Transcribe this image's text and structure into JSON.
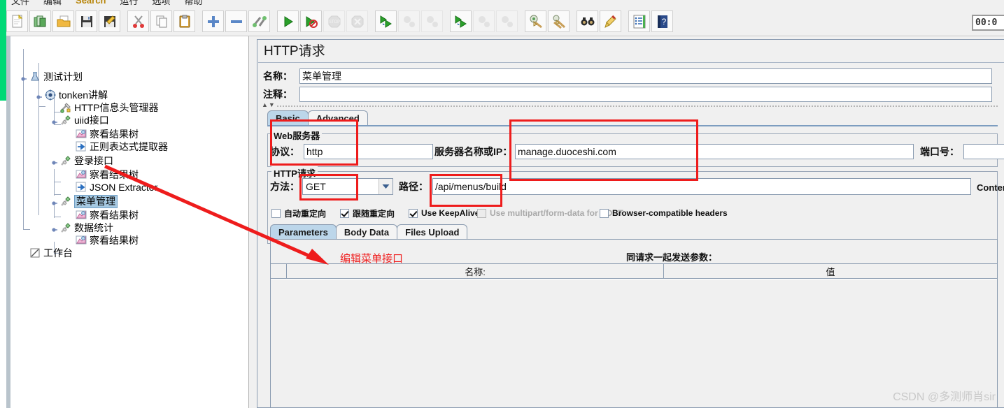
{
  "app": {
    "watermark": "CSDN @多测师肖sir",
    "timer": "00:0"
  },
  "menubar": {
    "items": [
      {
        "label": "文件",
        "accent": false
      },
      {
        "label": "编辑",
        "accent": false
      },
      {
        "label": "Search",
        "accent": true
      },
      {
        "label": "运行",
        "accent": false
      },
      {
        "label": "选项",
        "accent": false
      },
      {
        "label": "帮助",
        "accent": false
      }
    ]
  },
  "toolbar": {
    "groups": [
      {
        "buttons": [
          {
            "name": "new-test-plan-icon",
            "disabled": false
          },
          {
            "name": "templates-icon",
            "disabled": false
          },
          {
            "name": "open-icon",
            "disabled": false
          },
          {
            "name": "save-icon",
            "disabled": false
          },
          {
            "name": "save-as-icon",
            "disabled": false
          }
        ]
      },
      {
        "buttons": [
          {
            "name": "cut-icon",
            "disabled": false
          },
          {
            "name": "copy-icon",
            "disabled": false
          },
          {
            "name": "paste-icon",
            "disabled": false
          }
        ]
      },
      {
        "buttons": [
          {
            "name": "expand-all-icon",
            "disabled": false
          },
          {
            "name": "collapse-all-icon",
            "disabled": false
          },
          {
            "name": "toggle-icon",
            "disabled": false
          }
        ]
      },
      {
        "buttons": [
          {
            "name": "start-icon",
            "disabled": false
          },
          {
            "name": "start-no-pauses-icon",
            "disabled": false
          },
          {
            "name": "stop-icon",
            "disabled": true
          },
          {
            "name": "shutdown-icon",
            "disabled": true
          }
        ]
      },
      {
        "buttons": [
          {
            "name": "remote-start-icon",
            "disabled": false
          },
          {
            "name": "remote-stop-icon",
            "disabled": true
          },
          {
            "name": "remote-shutdown-icon",
            "disabled": true
          }
        ]
      },
      {
        "buttons": [
          {
            "name": "remote-start-all-icon",
            "disabled": false
          },
          {
            "name": "remote-stop-all-icon",
            "disabled": true
          },
          {
            "name": "remote-shutdown-all-icon",
            "disabled": true
          }
        ]
      },
      {
        "buttons": [
          {
            "name": "clear-icon",
            "disabled": false
          },
          {
            "name": "clear-all-icon",
            "disabled": false
          }
        ]
      },
      {
        "buttons": [
          {
            "name": "search-icon",
            "disabled": false
          },
          {
            "name": "clear-search-icon",
            "disabled": false
          }
        ]
      },
      {
        "buttons": [
          {
            "name": "function-helper-icon",
            "disabled": false
          },
          {
            "name": "help-icon",
            "disabled": false
          }
        ]
      }
    ]
  },
  "tree": {
    "nodes": [
      {
        "label": "测试计划",
        "depth": 0,
        "icon": "test-plan-icon",
        "selected": false,
        "expanded": true
      },
      {
        "label": "tonken讲解",
        "depth": 1,
        "icon": "thread-group-icon",
        "selected": false,
        "expanded": true
      },
      {
        "label": "HTTP信息头管理器",
        "depth": 2,
        "icon": "header-manager-icon",
        "selected": false,
        "expanded": null
      },
      {
        "label": "uiid接口",
        "depth": 2,
        "icon": "http-sampler-icon",
        "selected": false,
        "expanded": true
      },
      {
        "label": "察看结果树",
        "depth": 3,
        "icon": "view-results-icon",
        "selected": false,
        "expanded": null
      },
      {
        "label": "正则表达式提取器",
        "depth": 3,
        "icon": "extractor-icon",
        "selected": false,
        "expanded": null
      },
      {
        "label": "登录接口",
        "depth": 2,
        "icon": "http-sampler-icon",
        "selected": false,
        "expanded": true
      },
      {
        "label": "察看结果树",
        "depth": 3,
        "icon": "view-results-icon",
        "selected": false,
        "expanded": null
      },
      {
        "label": "JSON Extractor",
        "depth": 3,
        "icon": "extractor-icon",
        "selected": false,
        "expanded": null
      },
      {
        "label": "菜单管理",
        "depth": 2,
        "icon": "http-sampler-icon",
        "selected": true,
        "expanded": true
      },
      {
        "label": "察看结果树",
        "depth": 3,
        "icon": "view-results-icon",
        "selected": false,
        "expanded": null
      },
      {
        "label": "数据统计",
        "depth": 2,
        "icon": "http-sampler-icon",
        "selected": false,
        "expanded": true
      },
      {
        "label": "察看结果树",
        "depth": 3,
        "icon": "view-results-icon",
        "selected": false,
        "expanded": null
      },
      {
        "label": "工作台",
        "depth": 1,
        "icon": "workbench-icon",
        "selected": false,
        "expanded": null
      }
    ]
  },
  "panel": {
    "title": "HTTP请求",
    "name_label": "名称：",
    "name_value": "菜单管理",
    "comment_label": "注释：",
    "comment_value": "",
    "tabs": [
      {
        "label": "Basic",
        "active": true
      },
      {
        "label": "Advanced",
        "active": false
      }
    ],
    "webserver": {
      "group_title": "Web服务器",
      "protocol_label": "协议：",
      "protocol_value": "http",
      "servername_label": "服务器名称或IP：",
      "servername_value": "manage.duoceshi.com",
      "port_label": "端口号：",
      "port_value": ""
    },
    "httprequest": {
      "group_title": "HTTP请求",
      "method_label": "方法：",
      "method_value": "GET",
      "path_label": "路径：",
      "path_value": "/api/menus/build",
      "content_encoding_label": "Conten",
      "checkboxes": [
        {
          "label": "自动重定向",
          "checked": false,
          "disabled": false
        },
        {
          "label": "跟随重定向",
          "checked": true,
          "disabled": false
        },
        {
          "label": "Use KeepAlive",
          "checked": true,
          "disabled": false
        },
        {
          "label": "Use multipart/form-data for POST",
          "checked": false,
          "disabled": true
        },
        {
          "label": "Browser-compatible headers",
          "checked": false,
          "disabled": false
        }
      ]
    },
    "param_tabs": [
      {
        "label": "Parameters",
        "active": true
      },
      {
        "label": "Body Data",
        "active": false
      },
      {
        "label": "Files Upload",
        "active": false
      }
    ],
    "params": {
      "send_label": "同请求一起发送参数：",
      "columns": [
        "名称:",
        "值"
      ],
      "rows": []
    }
  },
  "annotations": {
    "note_text": "编辑菜单接口",
    "accent_color": "#ee1c1c"
  }
}
